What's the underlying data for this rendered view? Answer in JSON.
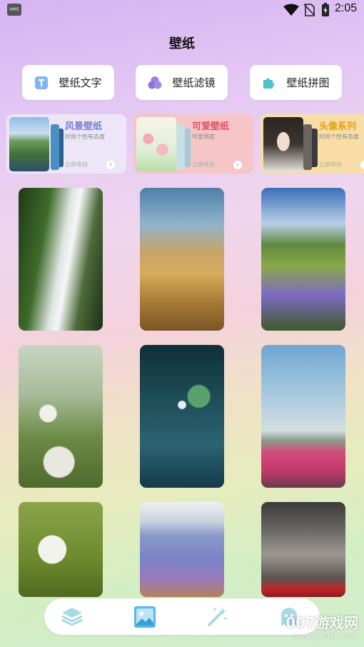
{
  "status_bar": {
    "badge": "HMS",
    "time": "2:05"
  },
  "page_title": "壁纸",
  "tools": [
    {
      "label": "壁纸文字",
      "icon": "text-t-icon"
    },
    {
      "label": "壁纸滤镜",
      "icon": "filter-circles-icon"
    },
    {
      "label": "壁纸拼图",
      "icon": "puzzle-piece-icon"
    }
  ],
  "categories": [
    {
      "title": "风景壁纸",
      "subtitle": "时尚个性有态度",
      "cta": "立即体验",
      "title_color": "#7b7fd4"
    },
    {
      "title": "可爱壁纸",
      "subtitle": "可爱俏皮",
      "cta": "立即体验",
      "title_color": "#e0506a"
    },
    {
      "title": "头像系列",
      "subtitle": "时尚个性有态度",
      "cta": "立即体验",
      "title_color": "#e3a019"
    }
  ],
  "wallpapers": [
    {
      "name": "waterfall-wallpaper"
    },
    {
      "name": "valley-wallpaper"
    },
    {
      "name": "lupine-meadow-wallpaper"
    },
    {
      "name": "dandelion-field-wallpaper"
    },
    {
      "name": "lily-pads-wallpaper"
    },
    {
      "name": "tulip-field-wallpaper"
    },
    {
      "name": "dandelion-wallpaper"
    },
    {
      "name": "lavender-wallpaper"
    },
    {
      "name": "garage-car-wallpaper"
    }
  ],
  "bottom_nav": [
    {
      "icon": "layers-icon",
      "active": false
    },
    {
      "icon": "image-icon",
      "active": true
    },
    {
      "icon": "magic-wand-icon",
      "active": false
    },
    {
      "icon": "ghost-icon",
      "active": false
    }
  ],
  "watermark": {
    "text": "007游戏网",
    "url": "www.yx007.com"
  }
}
